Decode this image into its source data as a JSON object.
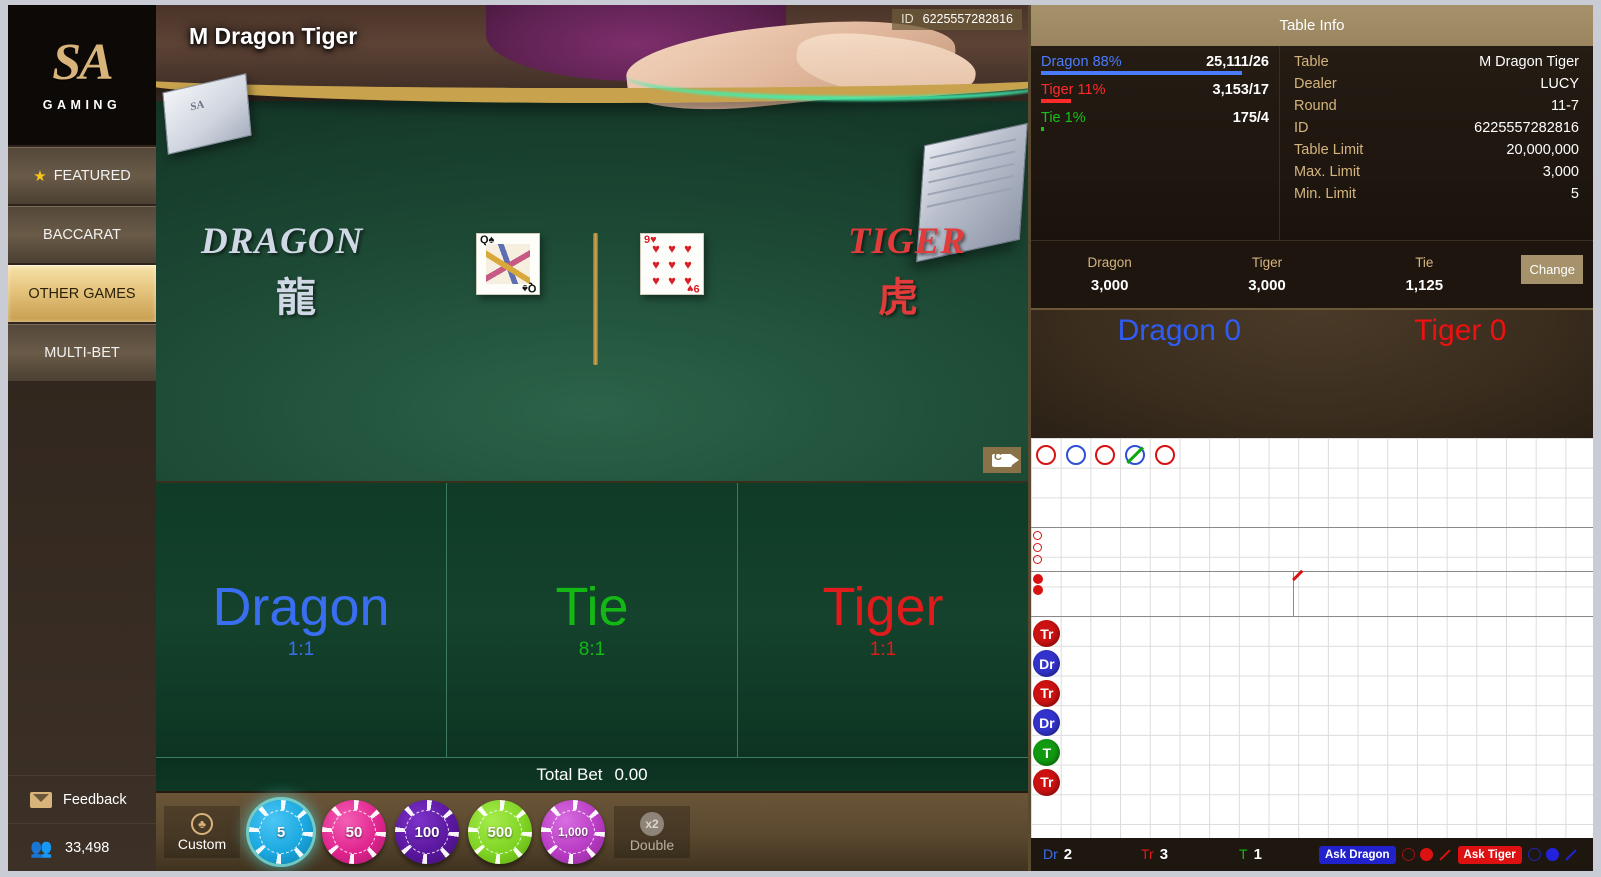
{
  "brand": {
    "logo_mark": "SA",
    "logo_text": "GAMING"
  },
  "sidebar": {
    "items": [
      {
        "label": "FEATURED",
        "icon": "star-icon",
        "active": false
      },
      {
        "label": "BACCARAT",
        "active": false
      },
      {
        "label": "OTHER GAMES",
        "active": true
      },
      {
        "label": "MULTI-BET",
        "active": false
      }
    ],
    "feedback_label": "Feedback",
    "feedback_icon": "mail-icon",
    "online_count": "33,498",
    "online_icon": "people-icon"
  },
  "video": {
    "title": "M Dragon Tiger",
    "id_label": "ID",
    "id_value": "6225557282816",
    "dragon_label": "DRAGON",
    "dragon_label_cn": "龍",
    "tiger_label": "TIGER",
    "tiger_label_cn": "虎",
    "camera_icon": "camera-switch-icon",
    "dragon_card": {
      "rank": "Q",
      "suit": "♠",
      "color": "#111111"
    },
    "tiger_card": {
      "rank": "9",
      "suit": "♥",
      "color": "#d81f26"
    }
  },
  "betting": {
    "spots": [
      {
        "name": "Dragon",
        "odds": "1:1",
        "color": "#3a6ef0",
        "cls": "c-dragon"
      },
      {
        "name": "Tie",
        "odds": "8:1",
        "color": "#14b814",
        "cls": "c-tie"
      },
      {
        "name": "Tiger",
        "odds": "1:1",
        "color": "#e01b1b",
        "cls": "c-tiger"
      }
    ],
    "total_bet_label": "Total Bet",
    "total_bet_value": "0.00"
  },
  "tray": {
    "custom_label": "Custom",
    "custom_icon": "custom-chip-icon",
    "double_label": "Double",
    "double_icon": "x2-icon",
    "chips": [
      {
        "value": "5",
        "color": "#1aa8e0",
        "dark": "#0e7ba8",
        "selected": true
      },
      {
        "value": "50",
        "color": "#e0248f",
        "dark": "#a8176a",
        "selected": false
      },
      {
        "value": "100",
        "color": "#5a179e",
        "dark": "#3d0f70",
        "selected": false
      },
      {
        "value": "500",
        "color": "#7fd423",
        "dark": "#5ba313",
        "selected": false
      },
      {
        "value": "1,000",
        "color": "#b83bc4",
        "dark": "#8a2794",
        "selected": false
      }
    ]
  },
  "table_info": {
    "header": "Table Info",
    "stats": [
      {
        "name": "Dragon 88%",
        "value": "25,111/26",
        "cls": "dragon",
        "pct": 88
      },
      {
        "name": "Tiger 11%",
        "value": "3,153/17",
        "cls": "tiger",
        "pct": 11
      },
      {
        "name": "Tie 1%",
        "value": "175/4",
        "cls": "tie",
        "pct": 1
      }
    ],
    "rows": [
      {
        "key": "Table",
        "value": "M Dragon Tiger"
      },
      {
        "key": "Dealer",
        "value": "LUCY"
      },
      {
        "key": "Round",
        "value": "11-7"
      },
      {
        "key": "ID",
        "value": "6225557282816"
      },
      {
        "key": "Table Limit",
        "value": "20,000,000"
      },
      {
        "key": "Max. Limit",
        "value": "3,000"
      },
      {
        "key": "Min. Limit",
        "value": "5"
      }
    ]
  },
  "limits": {
    "columns": [
      {
        "key": "Dragon",
        "value": "3,000"
      },
      {
        "key": "Tiger",
        "value": "3,000"
      },
      {
        "key": "Tie",
        "value": "1,125"
      }
    ],
    "change_label": "Change"
  },
  "scoreboard": {
    "dragon_label": "Dragon",
    "dragon_score": "0",
    "tiger_label": "Tiger",
    "tiger_score": "0"
  },
  "roads": {
    "big_road": [
      {
        "type": "t",
        "tie": false
      },
      {
        "type": "d",
        "tie": false
      },
      {
        "type": "t",
        "tie": false
      },
      {
        "type": "d",
        "tie": true
      },
      {
        "type": "t",
        "tie": false
      }
    ],
    "big_eye_road": [
      "t",
      "t",
      "t"
    ],
    "small_road": [
      "t",
      "t"
    ],
    "cockroach_road": [
      "t"
    ],
    "bead_road": [
      {
        "label": "Tr",
        "cls": "Tr"
      },
      {
        "label": "Dr",
        "cls": "Dr"
      },
      {
        "label": "Tr",
        "cls": "Tr"
      },
      {
        "label": "Dr",
        "cls": "Dr"
      },
      {
        "label": "T",
        "cls": "T"
      },
      {
        "label": "Tr",
        "cls": "Tr"
      }
    ],
    "counts": [
      {
        "key": "Dr",
        "value": "2",
        "cls": "dragon"
      },
      {
        "key": "Tr",
        "value": "3",
        "cls": "tiger"
      },
      {
        "key": "T",
        "value": "1",
        "cls": "tie"
      }
    ],
    "ask_dragon_label": "Ask Dragon",
    "ask_tiger_label": "Ask Tiger"
  }
}
